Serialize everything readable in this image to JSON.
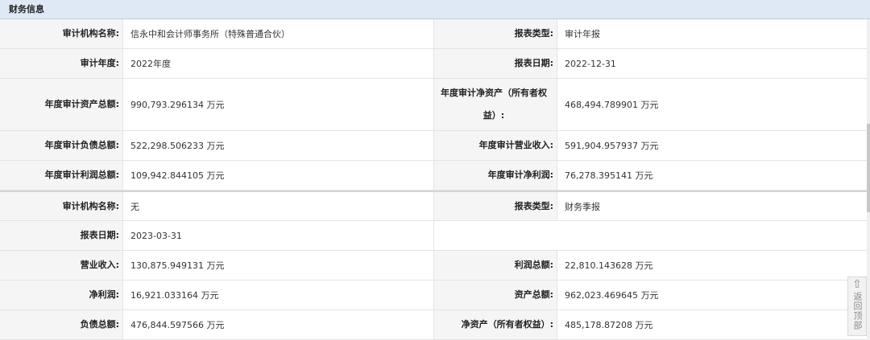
{
  "header": {
    "title": "财务信息"
  },
  "annual": {
    "rows": [
      {
        "l1": "审计机构名称:",
        "v1": "信永中和会计师事务所（特殊普通合伙）",
        "l2": "报表类型:",
        "v2": "审计年报"
      },
      {
        "l1": "审计年度:",
        "v1": "2022年度",
        "l2": "报表日期:",
        "v2": "2022-12-31"
      },
      {
        "l1": "年度审计资产总额:",
        "v1": "990,793.296134 万元",
        "l2a": "年度审计净资产（所有者权",
        "l2b": "益）:",
        "v2": "468,494.789901 万元"
      },
      {
        "l1": "年度审计负债总额:",
        "v1": "522,298.506233 万元",
        "l2": "年度审计营业收入:",
        "v2": "591,904.957937 万元"
      },
      {
        "l1": "年度审计利润总额:",
        "v1": "109,942.844105 万元",
        "l2": "年度审计净利润:",
        "v2": "76,278.395141 万元"
      }
    ]
  },
  "quarter": {
    "rows": [
      {
        "l1": "审计机构名称:",
        "v1": "无",
        "l2": "报表类型:",
        "v2": "财务季报"
      },
      {
        "l1": "报表日期:",
        "v1": "2023-03-31"
      },
      {
        "l1": "营业收入:",
        "v1": "130,875.949131 万元",
        "l2": "利润总额:",
        "v2": "22,810.143628 万元"
      },
      {
        "l1": "净利润:",
        "v1": "16,921.033164 万元",
        "l2": "资产总额:",
        "v2": "962,023.469645 万元"
      },
      {
        "l1": "负债总额:",
        "v1": "476,844.597566 万元",
        "l2": "净资产（所有者权益）:",
        "v2": "485,178.87208 万元"
      }
    ]
  },
  "backtop": {
    "arrow": "⇧",
    "label": "返回顶部"
  }
}
